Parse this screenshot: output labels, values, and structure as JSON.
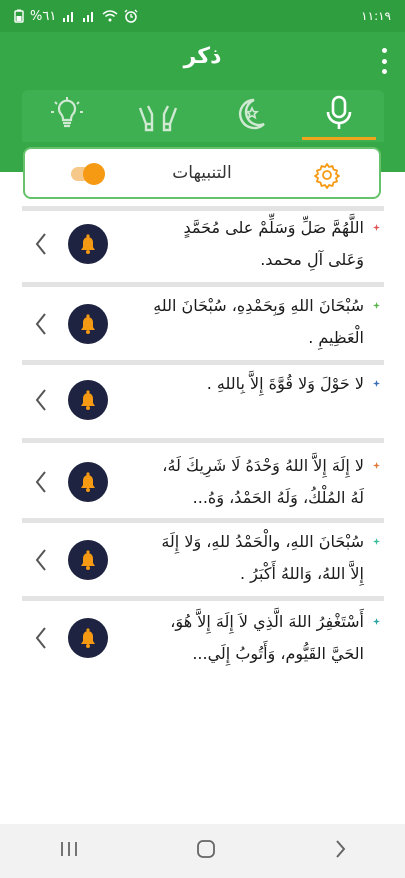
{
  "status_bar": {
    "time": "١١:١٩",
    "battery": "%٦١"
  },
  "app_bar": {
    "title": "ذكر"
  },
  "tabs": [
    {
      "icon": "microphone-icon",
      "active": true
    },
    {
      "icon": "crescent-star-icon",
      "active": false
    },
    {
      "icon": "praying-hands-icon",
      "active": false
    },
    {
      "icon": "lightbulb-icon",
      "active": false
    }
  ],
  "settings": {
    "label": "التنبيهات",
    "toggle_on": true
  },
  "colors": {
    "primary": "#36a848",
    "accent": "#f59a12",
    "bell_bg": "#1d2340",
    "bell": "#f59a12"
  },
  "items": [
    {
      "text": "اللَّهُمَّ صَلِّ وَسَلِّمْ على مُحَمَّدٍ وَعَلى آلِ محمد.",
      "bullet_color": "#e05555"
    },
    {
      "text": "سُبْحَانَ اللهِ وَبِحَمْدِهِ، سُبْحَانَ اللهِ الْعَظِيمِ .",
      "bullet_color": "#58b548"
    },
    {
      "text": "لا حَوْلَ وَلا قُوَّةَ إِلاَّ بِاللهِ .",
      "bullet_color": "#3b6fb8"
    },
    {
      "text": "لا إِلَهَ إِلاَّ اللهُ وَحْدَهُ لَا شَرِيكَ لَهُ، لَهُ المُلْكُ، وَلَهُ الحَمْدُ، وَهُ...",
      "bullet_color": "#e07a35"
    },
    {
      "text": "سُبْحَانَ اللهِ، والْحَمْدُ للهِ، وَلا إِلَهَ إِلاَّ اللهُ، وَاللهُ أَكْبَرُ .",
      "bullet_color": "#3bbf9d"
    },
    {
      "text": "أَسْتَغْفِرُ اللهَ الَّذِي لاَ إِلَهَ إِلاَّ هُوَ، الحَيَّ القَيُّوم، وَأَتُوبُ إِلَي...",
      "bullet_color": "#2aa3a3"
    }
  ]
}
